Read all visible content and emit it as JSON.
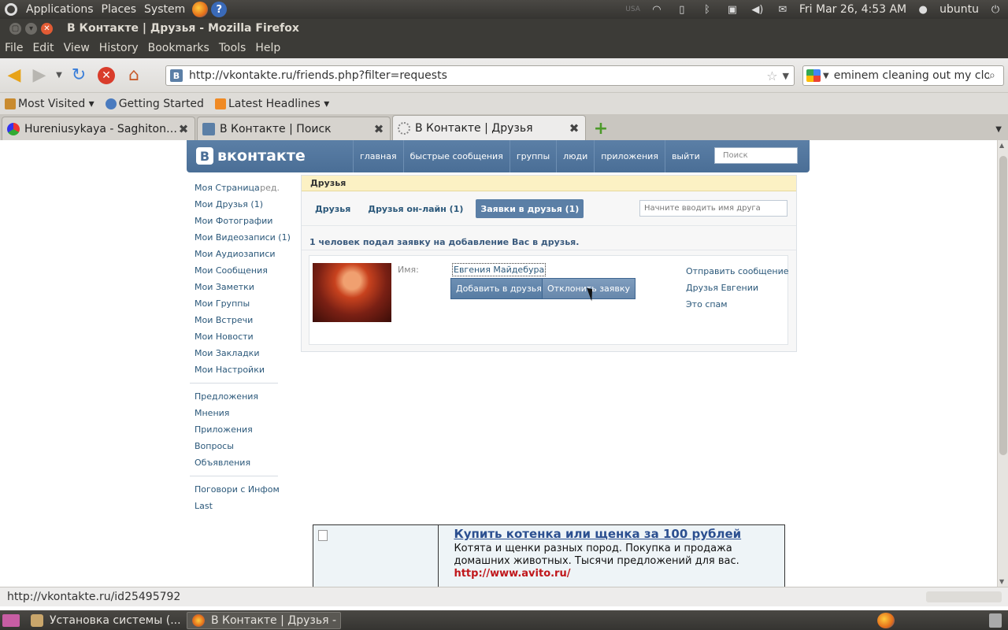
{
  "gnome": {
    "menus": [
      "Applications",
      "Places",
      "System"
    ],
    "tray": {
      "keyboard": "USA",
      "datetime": "Fri Mar 26,  4:53 AM",
      "user": "ubuntu"
    }
  },
  "window": {
    "title": "В Контакте | Друзья - Mozilla Firefox"
  },
  "menubar": [
    "File",
    "Edit",
    "View",
    "History",
    "Bookmarks",
    "Tools",
    "Help"
  ],
  "navbar": {
    "url": "http://vkontakte.ru/friends.php?filter=requests",
    "search": "eminem cleaning out my clos"
  },
  "bookmarks": [
    {
      "label": "Most Visited ▾",
      "icon": "folder-icon"
    },
    {
      "label": "Getting Started",
      "icon": "bookmark-icon"
    },
    {
      "label": "Latest Headlines ▾",
      "icon": "rss-icon"
    }
  ],
  "tabs": [
    {
      "label": "Hureniusykaya - Saghiton -...",
      "active": false
    },
    {
      "label": "В Контакте | Поиск",
      "active": false
    },
    {
      "label": "В Контакте | Друзья",
      "active": true
    }
  ],
  "vk": {
    "logo": "вконтакте",
    "nav": [
      "главная",
      "быстрые сообщения",
      "группы",
      "люди",
      "приложения",
      "выйти"
    ],
    "search_placeholder": "Поиск",
    "left_nav": [
      "Моя Страница",
      "Мои Друзья (1)",
      "Мои Фотографии",
      "Мои Видеозаписи (1)",
      "Мои Аудиозаписи",
      "Мои Сообщения",
      "Мои Заметки",
      "Мои Группы",
      "Мои Встречи",
      "Мои Новости",
      "Мои Закладки",
      "Мои Настройки"
    ],
    "left_nav_edit": "ред.",
    "left_nav2": [
      "Предложения",
      "Мнения",
      "Приложения",
      "Вопросы",
      "Объявления"
    ],
    "left_nav3": [
      "Поговори с Инфом",
      "Last"
    ],
    "panel_title": "Друзья",
    "friend_tabs": [
      "Друзья",
      "Друзья он-лайн (1)",
      "Заявки в друзья (1)"
    ],
    "friend_filter_placeholder": "Начните вводить имя друга",
    "request_count": "1 человек подал заявку на добавление Вас в друзья.",
    "request": {
      "name_label": "Имя:",
      "name": "Евгения Майдебура",
      "add_btn": "Добавить в друзья",
      "decline_btn": "Отклонить заявку",
      "actions": [
        "Отправить сообщение",
        "Друзья Евгении",
        "Это спам"
      ]
    }
  },
  "ad": {
    "title": "Купить котенка или щенка за 100 рублей",
    "desc": "Котята и щенки разных пород. Покупка и продажа домашних животных. Тысячи предложений для вас.",
    "url": "http://www.avito.ru/"
  },
  "status": "http://vkontakte.ru/id25495792",
  "taskbar": [
    "Установка системы (...",
    "В Контакте | Друзья - ..."
  ]
}
